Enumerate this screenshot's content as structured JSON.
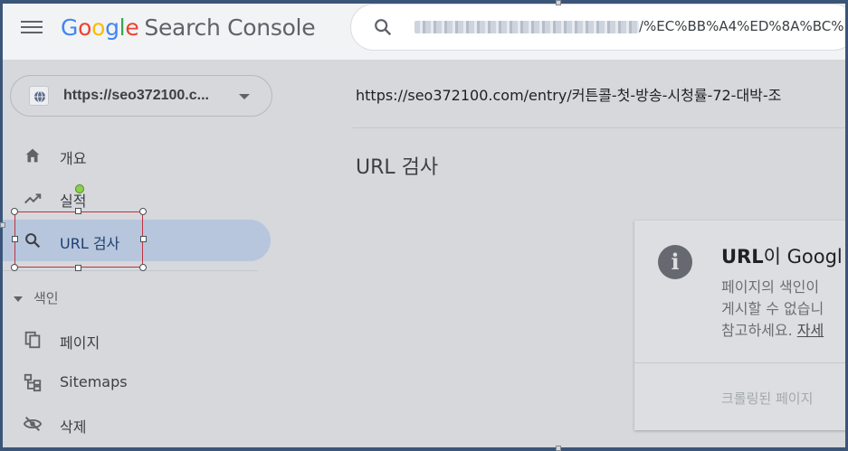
{
  "topbar": {
    "brand_letters": [
      "G",
      "o",
      "o",
      "g",
      "l",
      "e"
    ],
    "product": "Search Console",
    "search_query_suffix": "/%EC%BB%A4%ED%8A%BC%"
  },
  "property": {
    "label": "https://seo372100.c..."
  },
  "sidebar": {
    "items": [
      {
        "label": "개요",
        "icon": "home-icon"
      },
      {
        "label": "실적",
        "icon": "trending-up-icon"
      },
      {
        "label": "URL 검사",
        "icon": "search-icon",
        "active": true
      }
    ],
    "section_label": "색인",
    "index_items": [
      {
        "label": "페이지",
        "icon": "pages-icon"
      },
      {
        "label": "Sitemaps",
        "icon": "sitemap-icon"
      },
      {
        "label": "삭제",
        "icon": "visibility-off-icon"
      }
    ]
  },
  "main": {
    "inspected_url": "https://seo372100.com/entry/커튼콜-첫-방송-시청률-72-대박-조",
    "page_title": "URL 검사",
    "card": {
      "head_a": "URL",
      "head_b": "이 Googl",
      "line1": "페이지의 색인이",
      "line2": "게시할 수 없습니",
      "line3_text": "참고하세요. ",
      "line3_link": "자세",
      "footer": "크롤링된 페이지"
    }
  },
  "colors": {
    "active_nav_bg": "#b7c6dc",
    "selection_border": "#c0323f"
  }
}
